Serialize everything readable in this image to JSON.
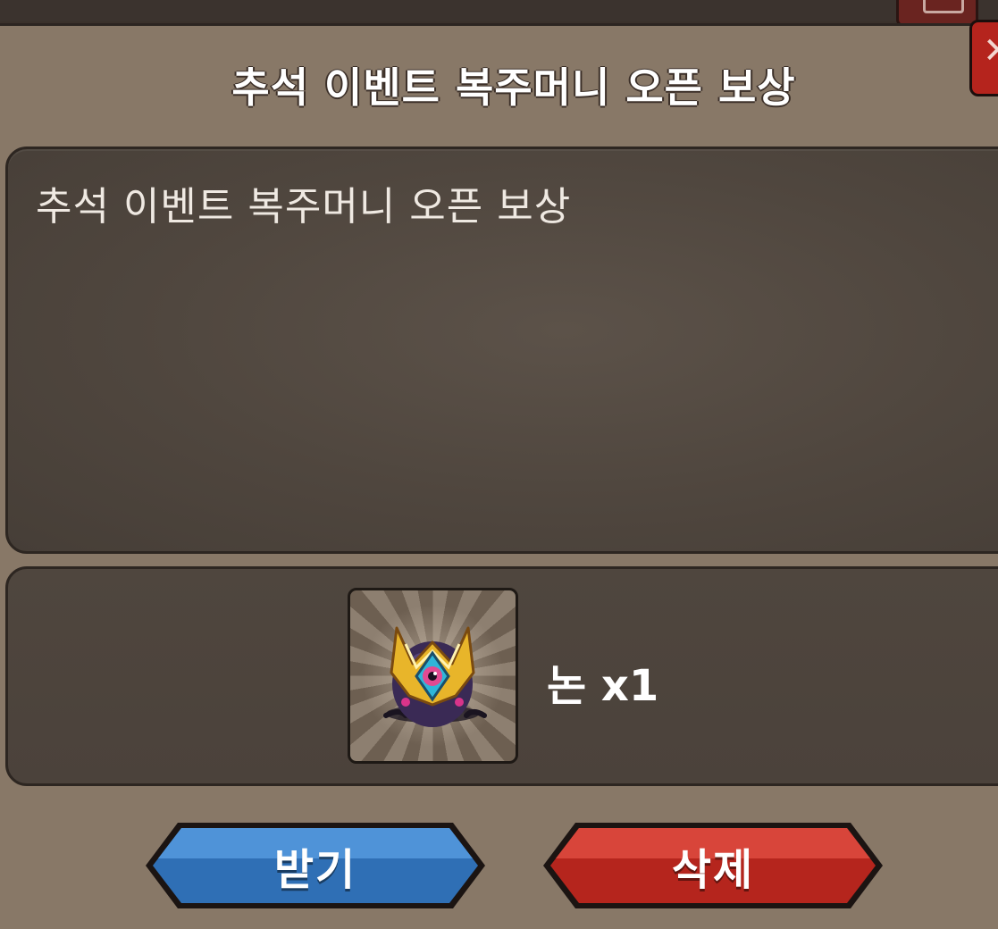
{
  "dialog": {
    "title": "추석 이벤트 복주머니 오픈 보상",
    "message": "추석 이벤트 복주머니 오픈 보상"
  },
  "reward": {
    "item_name": "알",
    "label": "논 x1",
    "icon": "golden-horned-egg-icon"
  },
  "buttons": {
    "receive_label": "받기",
    "delete_label": "삭제"
  },
  "colors": {
    "panel": "#887867",
    "box": "#4f463e",
    "receive": "#2f6fb5",
    "delete": "#b5251d"
  }
}
